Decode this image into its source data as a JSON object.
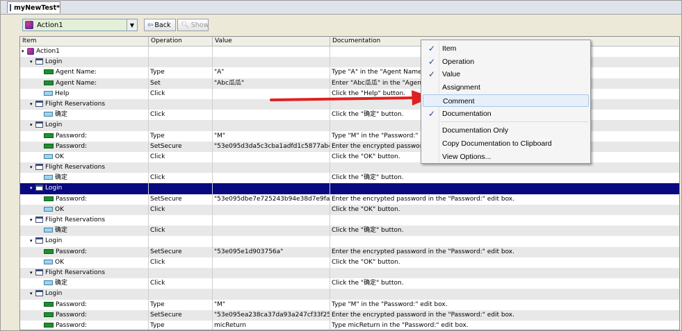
{
  "tab": {
    "title": "myNewTest*"
  },
  "toolbar": {
    "action_value": "Action1",
    "back_label": "Back",
    "show_label": "Show"
  },
  "columns": [
    "Item",
    "Operation",
    "Value",
    "Documentation"
  ],
  "rows": [
    {
      "indent": 0,
      "expander": "▾",
      "icon": "action",
      "item": "Action1",
      "op": "",
      "val": "",
      "doc": ""
    },
    {
      "indent": 1,
      "expander": "▾",
      "icon": "window",
      "item": "Login",
      "op": "",
      "val": "",
      "doc": ""
    },
    {
      "indent": 2,
      "expander": "",
      "icon": "edit",
      "item": "Agent Name:",
      "op": "Type",
      "val": "\"A\"",
      "doc": "Type \"A\" in the \"Agent Name:\" e"
    },
    {
      "indent": 2,
      "expander": "",
      "icon": "edit",
      "item": "Agent Name:",
      "op": "Set",
      "val": "\"Abc瓜瓜\"",
      "doc": "Enter \"Abc瓜瓜\" in the \"Agent N"
    },
    {
      "indent": 2,
      "expander": "",
      "icon": "button",
      "item": "Help",
      "op": "Click",
      "val": "",
      "doc": "Click the \"Help\" button."
    },
    {
      "indent": 1,
      "expander": "▾",
      "icon": "window",
      "item": "Flight Reservations",
      "op": "",
      "val": "",
      "doc": ""
    },
    {
      "indent": 2,
      "expander": "",
      "icon": "button",
      "item": "确定",
      "op": "Click",
      "val": "",
      "doc": "Click the \"确定\" button."
    },
    {
      "indent": 1,
      "expander": "▾",
      "icon": "window",
      "item": "Login",
      "op": "",
      "val": "",
      "doc": ""
    },
    {
      "indent": 2,
      "expander": "",
      "icon": "edit",
      "item": "Password:",
      "op": "Type",
      "val": "\"M\"",
      "doc": "Type \"M\" in the \"Password:\" edit"
    },
    {
      "indent": 2,
      "expander": "",
      "icon": "edit",
      "item": "Password:",
      "op": "SetSecure",
      "val": "\"53e095d3da5c3cba1adfd1c5877ab4...",
      "doc": "Enter the encrypted password in t"
    },
    {
      "indent": 2,
      "expander": "",
      "icon": "button",
      "item": "OK",
      "op": "Click",
      "val": "",
      "doc": "Click the \"OK\" button."
    },
    {
      "indent": 1,
      "expander": "▾",
      "icon": "window",
      "item": "Flight Reservations",
      "op": "",
      "val": "",
      "doc": ""
    },
    {
      "indent": 2,
      "expander": "",
      "icon": "button",
      "item": "确定",
      "op": "Click",
      "val": "",
      "doc": "Click the \"确定\" button."
    },
    {
      "indent": 1,
      "expander": "▾",
      "icon": "window",
      "item": "Login",
      "op": "",
      "val": "",
      "doc": "",
      "selected": true
    },
    {
      "indent": 2,
      "expander": "",
      "icon": "edit",
      "item": "Password:",
      "op": "SetSecure",
      "val": "\"53e095dbe7e725243b94e38d7e9faa...",
      "doc": "Enter the encrypted password in the \"Password:\" edit box."
    },
    {
      "indent": 2,
      "expander": "",
      "icon": "button",
      "item": "OK",
      "op": "Click",
      "val": "",
      "doc": "Click the \"OK\" button."
    },
    {
      "indent": 1,
      "expander": "▾",
      "icon": "window",
      "item": "Flight Reservations",
      "op": "",
      "val": "",
      "doc": ""
    },
    {
      "indent": 2,
      "expander": "",
      "icon": "button",
      "item": "确定",
      "op": "Click",
      "val": "",
      "doc": "Click the \"确定\" button."
    },
    {
      "indent": 1,
      "expander": "▾",
      "icon": "window",
      "item": "Login",
      "op": "",
      "val": "",
      "doc": ""
    },
    {
      "indent": 2,
      "expander": "",
      "icon": "edit",
      "item": "Password:",
      "op": "SetSecure",
      "val": "\"53e095e1d903756a\"",
      "doc": "Enter the encrypted password in the \"Password:\" edit box."
    },
    {
      "indent": 2,
      "expander": "",
      "icon": "button",
      "item": "OK",
      "op": "Click",
      "val": "",
      "doc": "Click the \"OK\" button."
    },
    {
      "indent": 1,
      "expander": "▾",
      "icon": "window",
      "item": "Flight Reservations",
      "op": "",
      "val": "",
      "doc": ""
    },
    {
      "indent": 2,
      "expander": "",
      "icon": "button",
      "item": "确定",
      "op": "Click",
      "val": "",
      "doc": "Click the \"确定\" button."
    },
    {
      "indent": 1,
      "expander": "▾",
      "icon": "window",
      "item": "Login",
      "op": "",
      "val": "",
      "doc": ""
    },
    {
      "indent": 2,
      "expander": "",
      "icon": "edit",
      "item": "Password:",
      "op": "Type",
      "val": "\"M\"",
      "doc": "Type \"M\" in the \"Password:\" edit box."
    },
    {
      "indent": 2,
      "expander": "",
      "icon": "edit",
      "item": "Password:",
      "op": "SetSecure",
      "val": "\"53e095ea238ca37da93a247cf33f25f...",
      "doc": "Enter the encrypted password in the \"Password:\" edit box."
    },
    {
      "indent": 2,
      "expander": "",
      "icon": "edit",
      "item": "Password:",
      "op": "Type",
      "val": "micReturn",
      "doc": "Type micReturn in the \"Password:\" edit box."
    }
  ],
  "context_menu": {
    "items": [
      {
        "label": "Item",
        "checked": true
      },
      {
        "label": "Operation",
        "checked": true
      },
      {
        "label": "Value",
        "checked": true
      },
      {
        "label": "Assignment",
        "checked": false
      },
      {
        "label": "Comment",
        "checked": false,
        "highlighted": true
      },
      {
        "label": "Documentation",
        "checked": true
      }
    ],
    "extra_items": [
      {
        "label": "Documentation Only"
      },
      {
        "label": "Copy Documentation to Clipboard"
      },
      {
        "label": "View Options..."
      }
    ]
  },
  "colors": {
    "selection": "#0a0a80",
    "arrow": "#e02020",
    "highlight": "#e7f0fa"
  }
}
